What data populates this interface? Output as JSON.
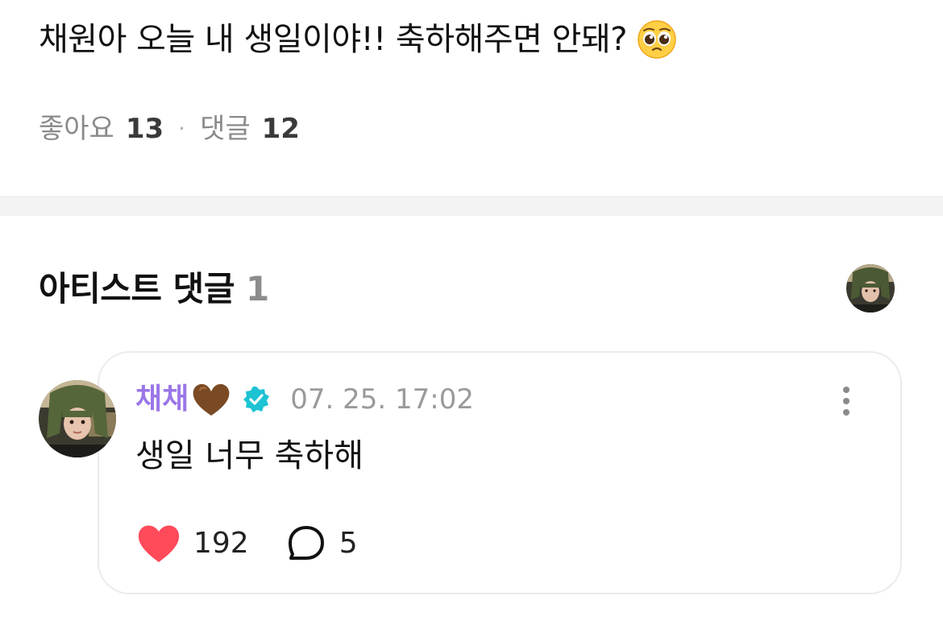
{
  "post": {
    "text": "채원아 오늘 내 생일이야!! 축하해주면 안돼?",
    "emoji": "pleading-face-emoji"
  },
  "stats": {
    "likes_label": "좋아요",
    "likes_count": "13",
    "separator": "·",
    "comments_label": "댓글",
    "comments_count": "12"
  },
  "artist_comments": {
    "title": "아티스트 댓글",
    "count": "1"
  },
  "comment": {
    "author": "채채",
    "author_emoji": "brown-heart-emoji",
    "verified_icon": "verified-badge-icon",
    "timestamp": "07. 25. 17:02",
    "body": "생일 너무 축하해",
    "likes": "192",
    "replies": "5"
  },
  "colors": {
    "author_name": "#9b76e8",
    "verified": "#1cc3d3",
    "like_heart": "#ff4a5a",
    "divider": "#f3f3f3",
    "card_border": "#ebebee"
  }
}
